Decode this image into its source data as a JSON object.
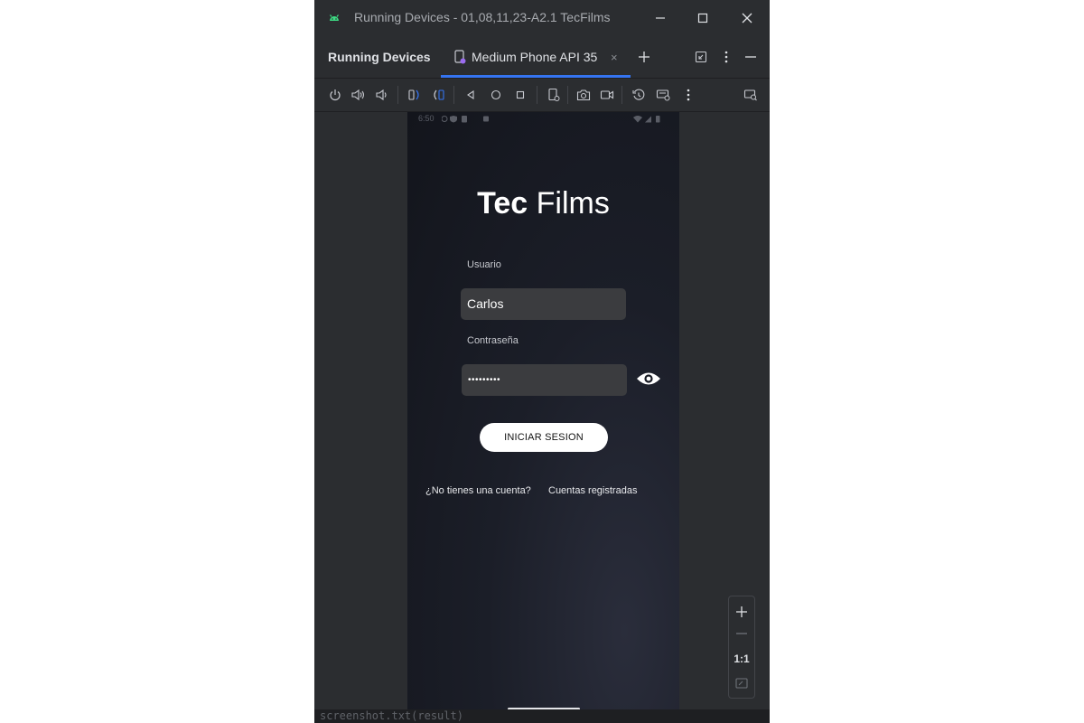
{
  "window": {
    "title": "Running Devices - 01,08,11,23-A2.1 TecFilms"
  },
  "tabbar": {
    "panel_title": "Running Devices",
    "tab_label": "Medium Phone API 35",
    "close_glyph": "×"
  },
  "phone": {
    "status_time": "6:50",
    "logo_bold": "Tec",
    "logo_light": " Films",
    "username_label": "Usuario",
    "username_value": "Carlos",
    "password_label": "Contraseña",
    "password_value": "•••••••••",
    "login_button": "INICIAR SESION",
    "no_account_link": "¿No tienes una cuenta?",
    "registered_accounts_link": "Cuentas registradas"
  },
  "zoom": {
    "one_to_one": "1:1"
  },
  "bottom_code": "screenshot.txt(result)",
  "colors": {
    "accent": "#3574f0",
    "android_green": "#3ddc84"
  }
}
